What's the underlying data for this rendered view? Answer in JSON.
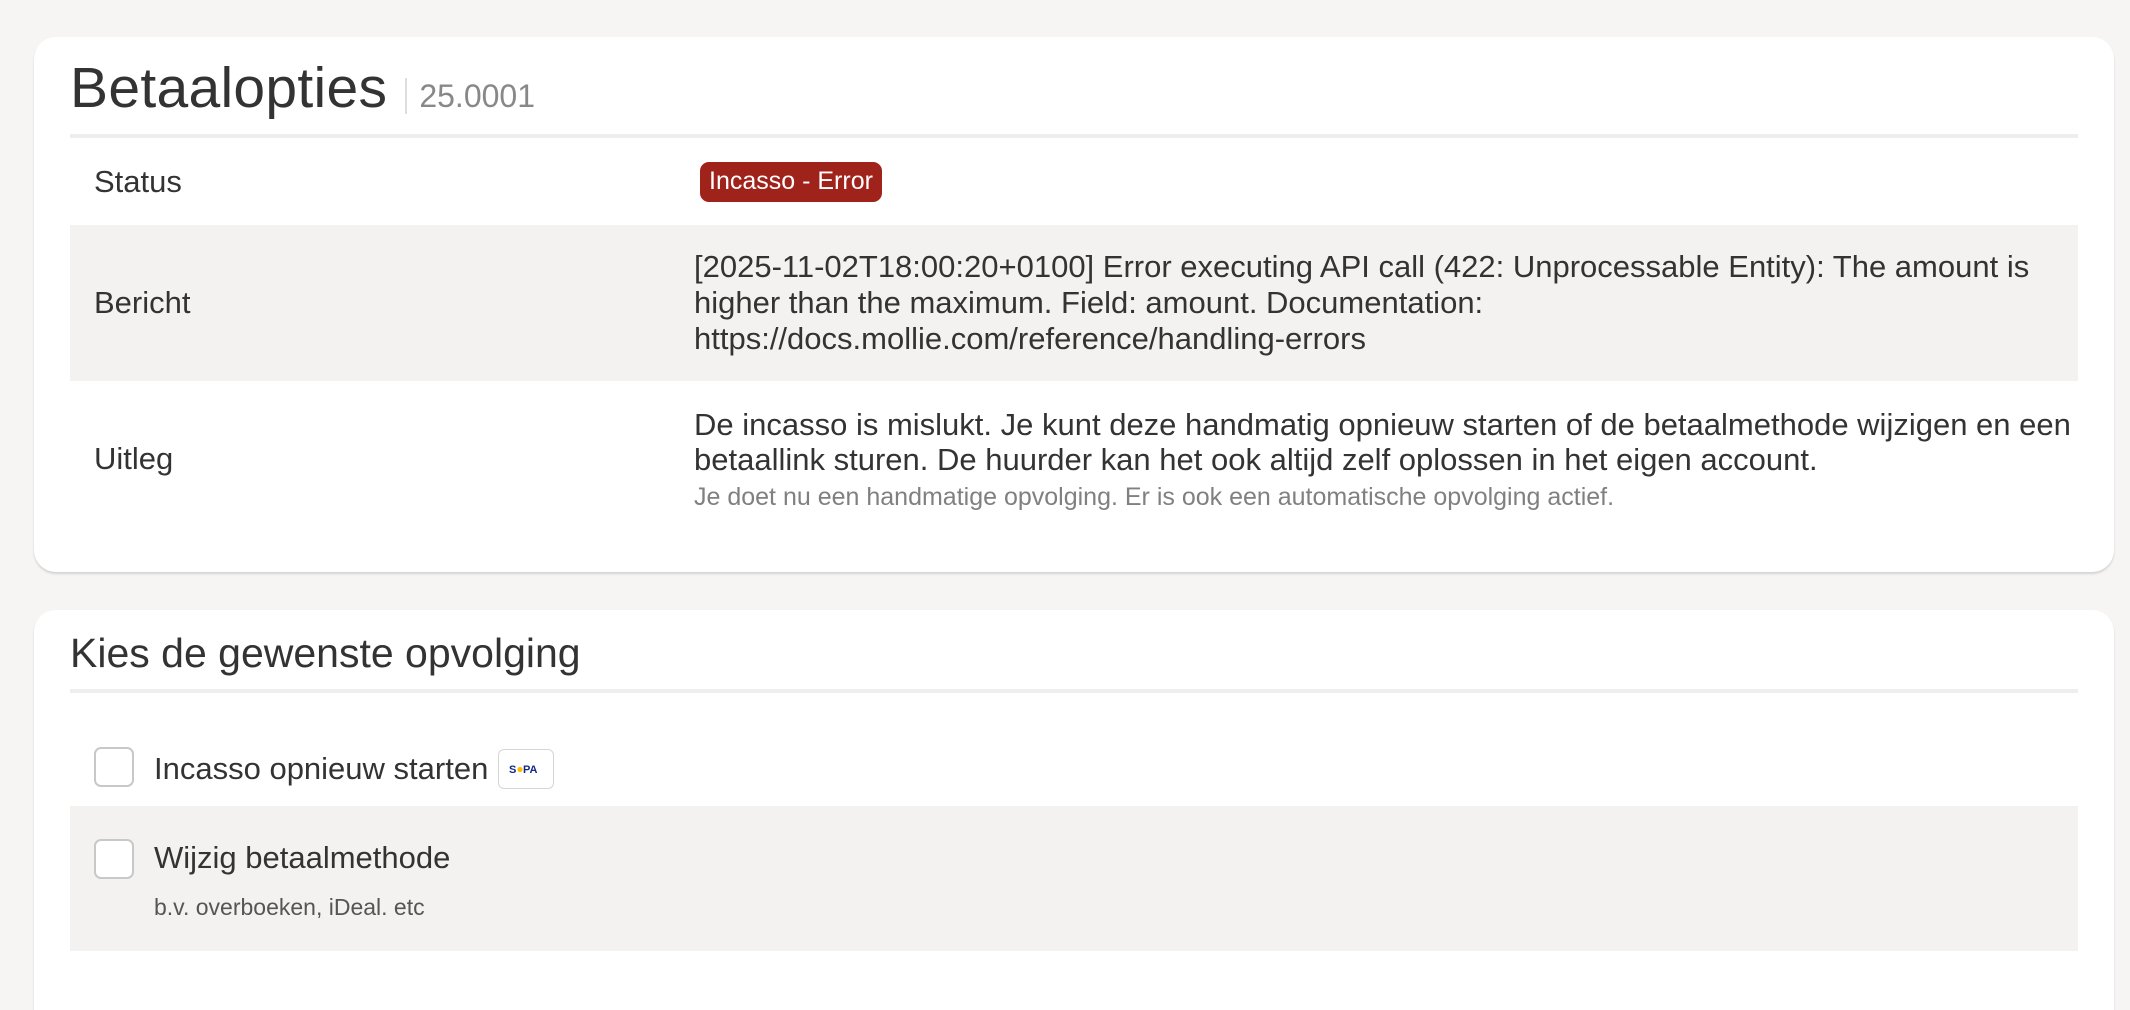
{
  "header": {
    "title": "Betaalopties",
    "subtitle": "25.0001"
  },
  "details": {
    "status_label": "Status",
    "status_badge": "Incasso - Error",
    "message_label": "Bericht",
    "message_text": "[2025-11-02T18:00:20+0100] Error executing API call (422: Unprocessable Entity): The amount is higher than the maximum. Field: amount. Documentation: https://docs.mollie.com/reference/handling-errors",
    "explain_label": "Uitleg",
    "explain_text": "De incasso is mislukt. Je kunt deze handmatig opnieuw starten of de betaalmethode wijzigen en een betaallink sturen. De huurder kan het ook altijd zelf oplossen in het eigen account.",
    "explain_note": "Je doet nu een handmatige opvolging. Er is ook een automatische opvolging actief."
  },
  "followup": {
    "title": "Kies de gewenste opvolging",
    "options": [
      {
        "label": "Incasso opnieuw starten",
        "icon": "sepa-icon",
        "checked": false
      },
      {
        "label": "Wijzig betaalmethode",
        "hint": "b.v. overboeken, iDeal. etc",
        "checked": false
      }
    ]
  },
  "colors": {
    "error_badge": "#a0231b",
    "page_background": "#f6f5f4",
    "stripe_row": "#f3f2f1"
  }
}
